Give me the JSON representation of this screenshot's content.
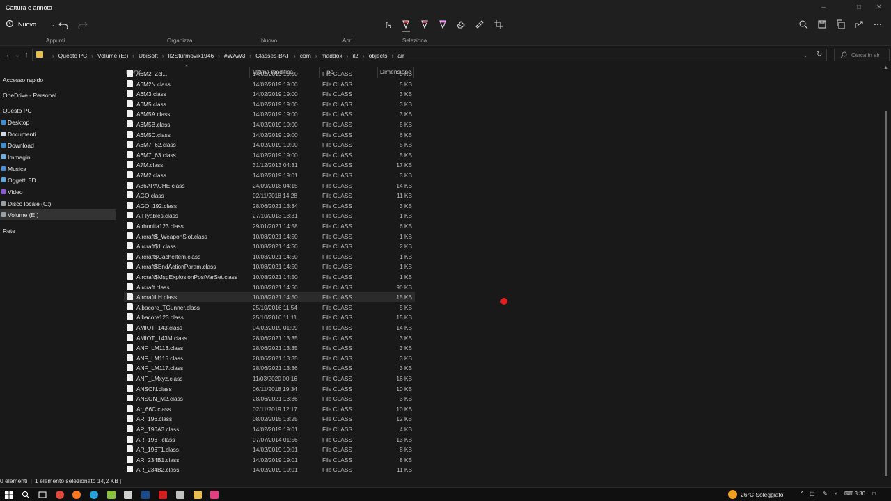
{
  "window": {
    "title": "Cattura e annota"
  },
  "snip": {
    "new_label": "Nuovo",
    "ribbon": [
      "Appunti",
      "Organizza",
      "Nuovo",
      "Apri",
      "Seleziona"
    ]
  },
  "address": {
    "crumbs": [
      "Questo PC",
      "Volume (E:)",
      "UbiSoft",
      "Il2Sturmovik1946",
      "#WAW3",
      "Classes-BAT",
      "com",
      "maddox",
      "il2",
      "objects",
      "air"
    ],
    "search_placeholder": "Cerca in air"
  },
  "sidebar": {
    "items": [
      {
        "label": "Accesso rapido",
        "icon": "star-icon",
        "color": ""
      },
      {
        "label": "OneDrive - Personal",
        "icon": "cloud-icon",
        "color": ""
      },
      {
        "label": "Questo PC",
        "icon": "computer-icon",
        "color": ""
      },
      {
        "label": "Desktop",
        "icon": "desktop-folder-icon",
        "color": "#3a8fd8"
      },
      {
        "label": "Documenti",
        "icon": "documents-folder-icon",
        "color": "#cfd8e0"
      },
      {
        "label": "Download",
        "icon": "download-folder-icon",
        "color": "#3a8fd8"
      },
      {
        "label": "Immagini",
        "icon": "pictures-folder-icon",
        "color": "#6fb0e0"
      },
      {
        "label": "Musica",
        "icon": "music-folder-icon",
        "color": "#4a90d8"
      },
      {
        "label": "Oggetti 3D",
        "icon": "3d-objects-icon",
        "color": "#5aa8e0"
      },
      {
        "label": "Video",
        "icon": "video-folder-icon",
        "color": "#8a5ad8"
      },
      {
        "label": "Disco locale (C:)",
        "icon": "drive-icon",
        "color": "#9aa0a8"
      },
      {
        "label": "Volume (E:)",
        "icon": "drive-icon",
        "color": "#9aa0a8"
      },
      {
        "label": "Rete",
        "icon": "network-icon",
        "color": ""
      }
    ],
    "selected": "Volume (E:)"
  },
  "columns": [
    "Nome",
    "Ultima modifica",
    "Tipo",
    "Dimensione"
  ],
  "files": [
    {
      "name": "A6M2_Zcl...",
      "date": "14/02/2019 19:00",
      "type": "File CLASS",
      "size": "3 KB"
    },
    {
      "name": "A6M2N.class",
      "date": "14/02/2019 19:00",
      "type": "File CLASS",
      "size": "5 KB"
    },
    {
      "name": "A6M3.class",
      "date": "14/02/2019 19:00",
      "type": "File CLASS",
      "size": "3 KB"
    },
    {
      "name": "A6M5.class",
      "date": "14/02/2019 19:00",
      "type": "File CLASS",
      "size": "3 KB"
    },
    {
      "name": "A6M5A.class",
      "date": "14/02/2019 19:00",
      "type": "File CLASS",
      "size": "3 KB"
    },
    {
      "name": "A6M5B.class",
      "date": "14/02/2019 19:00",
      "type": "File CLASS",
      "size": "5 KB"
    },
    {
      "name": "A6M5C.class",
      "date": "14/02/2019 19:00",
      "type": "File CLASS",
      "size": "6 KB"
    },
    {
      "name": "A6M7_62.class",
      "date": "14/02/2019 19:00",
      "type": "File CLASS",
      "size": "5 KB"
    },
    {
      "name": "A6M7_63.class",
      "date": "14/02/2019 19:00",
      "type": "File CLASS",
      "size": "5 KB"
    },
    {
      "name": "A7M.class",
      "date": "31/12/2013 04:31",
      "type": "File CLASS",
      "size": "17 KB"
    },
    {
      "name": "A7M2.class",
      "date": "14/02/2019 19:01",
      "type": "File CLASS",
      "size": "3 KB"
    },
    {
      "name": "A36APACHE.class",
      "date": "24/09/2018 04:15",
      "type": "File CLASS",
      "size": "14 KB"
    },
    {
      "name": "AGO.class",
      "date": "02/11/2018 14:28",
      "type": "File CLASS",
      "size": "11 KB"
    },
    {
      "name": "AGO_192.class",
      "date": "28/06/2021 13:34",
      "type": "File CLASS",
      "size": "3 KB"
    },
    {
      "name": "AIFlyables.class",
      "date": "27/10/2013 13:31",
      "type": "File CLASS",
      "size": "1 KB"
    },
    {
      "name": "Airbonita123.class",
      "date": "29/01/2021 14:58",
      "type": "File CLASS",
      "size": "6 KB"
    },
    {
      "name": "Aircraft$_WeaponSlot.class",
      "date": "10/08/2021 14:50",
      "type": "File CLASS",
      "size": "1 KB"
    },
    {
      "name": "Aircraft$1.class",
      "date": "10/08/2021 14:50",
      "type": "File CLASS",
      "size": "2 KB"
    },
    {
      "name": "Aircraft$CacheItem.class",
      "date": "10/08/2021 14:50",
      "type": "File CLASS",
      "size": "1 KB"
    },
    {
      "name": "Aircraft$EndActionParam.class",
      "date": "10/08/2021 14:50",
      "type": "File CLASS",
      "size": "1 KB"
    },
    {
      "name": "Aircraft$MsgExplosionPostVarSet.class",
      "date": "10/08/2021 14:50",
      "type": "File CLASS",
      "size": "1 KB"
    },
    {
      "name": "Aircraft.class",
      "date": "10/08/2021 14:50",
      "type": "File CLASS",
      "size": "90 KB"
    },
    {
      "name": "AircraftLH.class",
      "date": "10/08/2021 14:50",
      "type": "File CLASS",
      "size": "15 KB",
      "selected": true
    },
    {
      "name": "Albacore_TGunner.class",
      "date": "25/10/2016 11:54",
      "type": "File CLASS",
      "size": "5 KB"
    },
    {
      "name": "Albacore123.class",
      "date": "25/10/2016 11:11",
      "type": "File CLASS",
      "size": "15 KB"
    },
    {
      "name": "AMIOT_143.class",
      "date": "04/02/2019 01:09",
      "type": "File CLASS",
      "size": "14 KB"
    },
    {
      "name": "AMIOT_143M.class",
      "date": "28/06/2021 13:35",
      "type": "File CLASS",
      "size": "3 KB"
    },
    {
      "name": "ANF_LM113.class",
      "date": "28/06/2021 13:35",
      "type": "File CLASS",
      "size": "3 KB"
    },
    {
      "name": "ANF_LM115.class",
      "date": "28/06/2021 13:35",
      "type": "File CLASS",
      "size": "3 KB"
    },
    {
      "name": "ANF_LM117.class",
      "date": "28/06/2021 13:36",
      "type": "File CLASS",
      "size": "3 KB"
    },
    {
      "name": "ANF_LMxyz.class",
      "date": "11/03/2020 00:16",
      "type": "File CLASS",
      "size": "16 KB"
    },
    {
      "name": "ANSON.class",
      "date": "06/11/2018 19:34",
      "type": "File CLASS",
      "size": "10 KB"
    },
    {
      "name": "ANSON_M2.class",
      "date": "28/06/2021 13:36",
      "type": "File CLASS",
      "size": "3 KB"
    },
    {
      "name": "Ar_66C.class",
      "date": "02/11/2019 12:17",
      "type": "File CLASS",
      "size": "10 KB"
    },
    {
      "name": "AR_196.class",
      "date": "08/02/2015 13:25",
      "type": "File CLASS",
      "size": "12 KB"
    },
    {
      "name": "AR_196A3.class",
      "date": "14/02/2019 19:01",
      "type": "File CLASS",
      "size": "4 KB"
    },
    {
      "name": "AR_196T.class",
      "date": "07/07/2014 01:56",
      "type": "File CLASS",
      "size": "13 KB"
    },
    {
      "name": "AR_196T1.class",
      "date": "14/02/2019 19:01",
      "type": "File CLASS",
      "size": "8 KB"
    },
    {
      "name": "AR_234B1.class",
      "date": "14/02/2019 19:01",
      "type": "File CLASS",
      "size": "8 KB"
    },
    {
      "name": "AR_234B2.class",
      "date": "14/02/2019 19:01",
      "type": "File CLASS",
      "size": "11 KB"
    }
  ],
  "status": {
    "count": "0 elementi",
    "selection": "1 elemento selezionato  14,2 KB"
  },
  "taskbar": {
    "weather": "26°C  Soleggiato",
    "time": "13:30"
  }
}
